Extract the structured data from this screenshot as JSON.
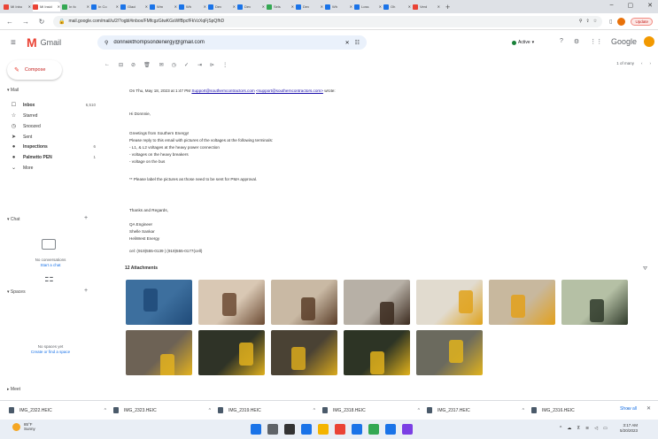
{
  "browser": {
    "tabs": [
      {
        "label": "Mi Inbo",
        "color": "#ea4335",
        "active": false
      },
      {
        "label": "Mi Insid",
        "color": "#ea4335",
        "active": true
      },
      {
        "label": "In fo",
        "color": "#34a853",
        "active": false
      },
      {
        "label": "In Co",
        "color": "#1a73e8",
        "active": false
      },
      {
        "label": "Glaci",
        "color": "#1a73e8",
        "active": false
      },
      {
        "label": "Wm",
        "color": "#1a73e8",
        "active": false
      },
      {
        "label": "Wh",
        "color": "#1a73e8",
        "active": false
      },
      {
        "label": "Dev",
        "color": "#1a73e8",
        "active": false
      },
      {
        "label": "Dev",
        "color": "#1a73e8",
        "active": false
      },
      {
        "label": "Sels",
        "color": "#34a853",
        "active": false
      },
      {
        "label": "Dev",
        "color": "#1a73e8",
        "active": false
      },
      {
        "label": "Wh",
        "color": "#1a73e8",
        "active": false
      },
      {
        "label": "Loss",
        "color": "#1a73e8",
        "active": false
      },
      {
        "label": "Oh",
        "color": "#1a73e8",
        "active": false
      },
      {
        "label": "Verd",
        "color": "#ea4335",
        "active": false
      }
    ],
    "new_tab": "+",
    "url": "mail.google.com/mail/u/2/?ogbl#inbox/FMfcgzGtwKGsWfBpcfFkVzXqFjSpQfhD",
    "update_label": "Update"
  },
  "gmail": {
    "brand": "Gmail",
    "search_value": "donniekthompsondenergy@gmail.com",
    "status": "Active",
    "google_label": "Google",
    "compose": "Compose",
    "mail_section": "Mail",
    "nav": [
      {
        "icon": "☐",
        "label": "Inbox",
        "count": "6,510",
        "bold": true,
        "icon_name": "inbox-icon"
      },
      {
        "icon": "☆",
        "label": "Starred",
        "count": "",
        "bold": false,
        "icon_name": "star-icon"
      },
      {
        "icon": "◷",
        "label": "Snoozed",
        "count": "",
        "bold": false,
        "icon_name": "clock-icon"
      },
      {
        "icon": "➤",
        "label": "Sent",
        "count": "",
        "bold": false,
        "icon_name": "send-icon"
      },
      {
        "icon": "●",
        "label": "Inspections",
        "count": "6",
        "bold": true,
        "icon_name": "label-icon"
      },
      {
        "icon": "●",
        "label": "Palmetto PEN",
        "count": "1",
        "bold": true,
        "icon_name": "label-icon"
      },
      {
        "icon": "⌄",
        "label": "More",
        "count": "",
        "bold": false,
        "icon_name": "chevron-down-icon"
      }
    ],
    "chat_section": "Chat",
    "chat_empty": "No conversations",
    "chat_link": "Start a chat",
    "spaces_section": "Spaces",
    "spaces_empty": "No spaces yet",
    "spaces_link": "Create or find a space",
    "meet_section": "Meet",
    "pager": "1 of many"
  },
  "message": {
    "header_prefix": "On Thu, May 18, 2023 at 1:47 PM",
    "header_link1": "Support@southerncontractors.com",
    "header_link2": "<support@southerncontractors.com>",
    "header_suffix": "wrote:",
    "greeting": "Hi Donnnie,",
    "intro": "Greetings from Southern Energy!",
    "request": "Please reply to this email with pictures of the voltages at the following terminals:",
    "item1": "- L1, & L2 voltages at the heavy power connection",
    "item2": "- voltages on the heavy breakers",
    "item3": "- voltage on the bus",
    "note": "** Please label the pictures as those need to be sent for PMA approval.",
    "thanks": "Thanks and Regards,",
    "sig1": "QA Engineer",
    "sig2": "Shelle Sankar",
    "sig3": "HeliWest Energy",
    "phone": "cel: (919)555-0139  |  (919)555-0177(cell)",
    "attachments_label": "12 Attachments"
  },
  "attachments": [
    {
      "bg": "#3d6f9e",
      "accent": "#1f4a78",
      "name": "photo-1"
    },
    {
      "bg": "#d9c8b4",
      "accent": "#6b4a32",
      "name": "photo-2"
    },
    {
      "bg": "#c9b9a4",
      "accent": "#5a3d28",
      "name": "photo-3"
    },
    {
      "bg": "#b7b0a6",
      "accent": "#3b2a1e",
      "name": "photo-4"
    },
    {
      "bg": "#e1dbcf",
      "accent": "#e0a21a",
      "name": "photo-5"
    },
    {
      "bg": "#c8b89e",
      "accent": "#e3a01a",
      "name": "photo-6"
    },
    {
      "bg": "#b5c0a5",
      "accent": "#2f3a2a",
      "name": "photo-7"
    },
    {
      "bg": "#6d6255",
      "accent": "#e3b21e",
      "name": "photo-8"
    },
    {
      "bg": "#2f3327",
      "accent": "#e0b01d",
      "name": "photo-9"
    },
    {
      "bg": "#4a4234",
      "accent": "#d9a91c",
      "name": "photo-10"
    },
    {
      "bg": "#2d3425",
      "accent": "#e2b21b",
      "name": "photo-11"
    },
    {
      "bg": "#6b6a5e",
      "accent": "#e1b31c",
      "name": "photo-12"
    }
  ],
  "downloads": [
    {
      "name": "IMG_2322.HEIC"
    },
    {
      "name": "IMG_2323.HEIC"
    },
    {
      "name": "IMG_2319.HEIC"
    },
    {
      "name": "IMG_2318.HEIC"
    },
    {
      "name": "IMG_2317.HEIC"
    },
    {
      "name": "IMG_2316.HEIC"
    }
  ],
  "download_showall": "Show all",
  "taskbar": {
    "temp": "85°F",
    "condition": "Sunny",
    "time": "3:17 AM",
    "date": "5/20/2023",
    "icons": [
      "#1a73e8",
      "#5f6368",
      "#333333",
      "#1a73e8",
      "#f4b400",
      "#ea4335",
      "#1a73e8",
      "#34a853",
      "#1a73e8",
      "#7b3fe4"
    ]
  }
}
